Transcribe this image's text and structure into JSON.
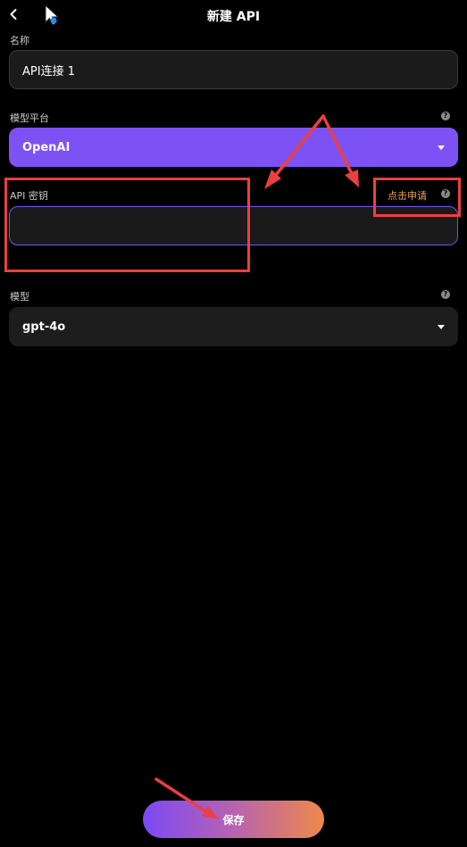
{
  "header": {
    "title": "新建 API"
  },
  "form": {
    "name_label": "名称",
    "name_value": "API连接 1",
    "platform_label": "模型平台",
    "platform_value": "OpenAI",
    "api_key_label": "API 密钥",
    "api_key_value": "",
    "apply_link": "点击申请",
    "model_label": "模型",
    "model_value": "gpt-4o"
  },
  "save_label": "保存",
  "colors": {
    "background": "#000000",
    "accent": "#7d52f4",
    "link": "#f0a052",
    "annotation": "#ec3f3f"
  }
}
